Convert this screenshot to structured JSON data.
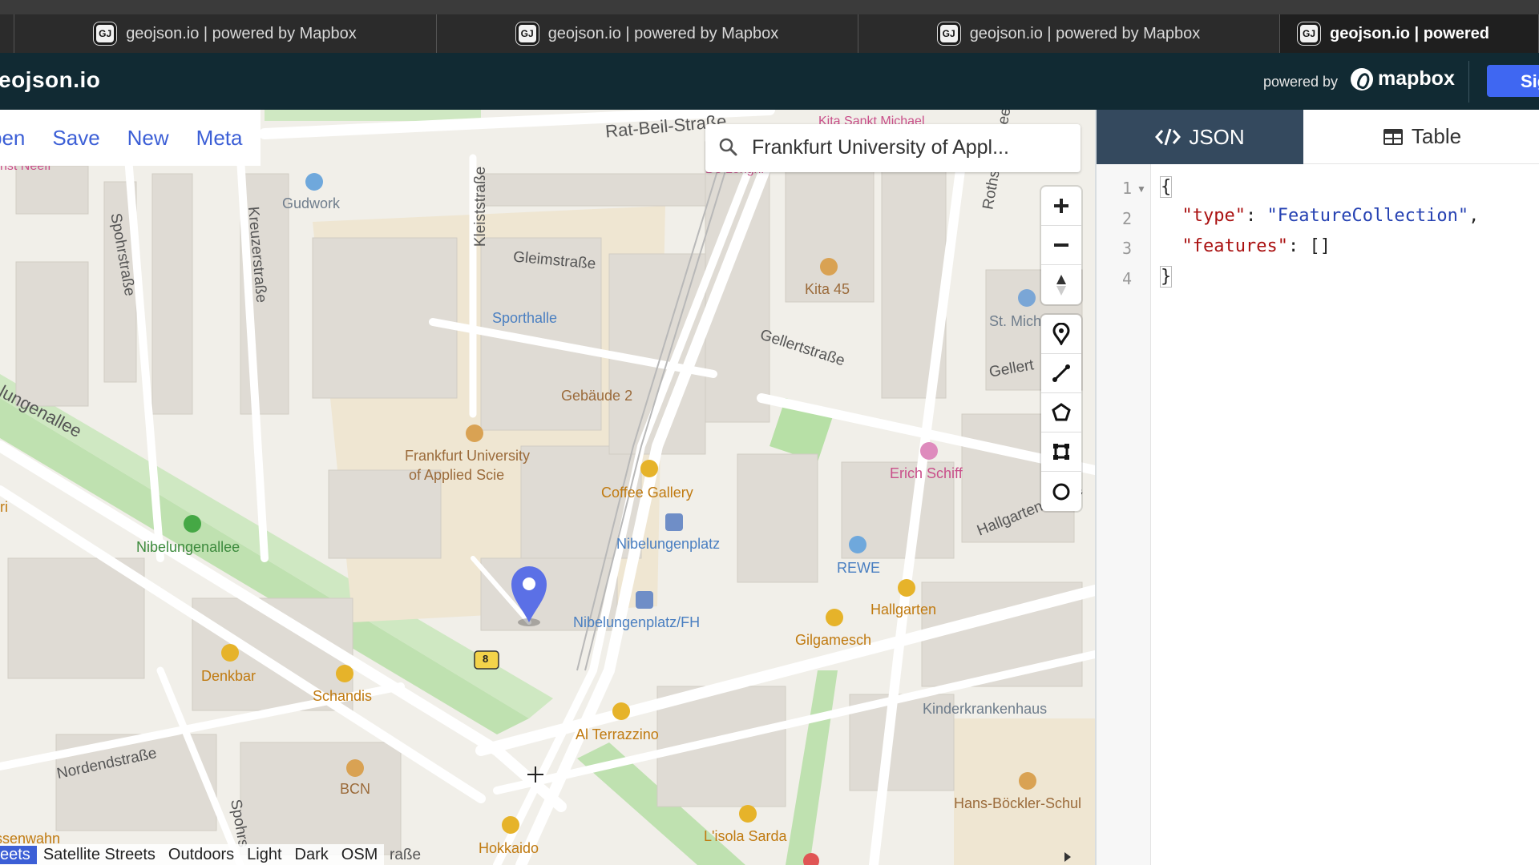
{
  "browser": {
    "tabs": [
      {
        "title": "geojson.io | powered by Mapbox",
        "favicon": "GJ"
      },
      {
        "title": "geojson.io | powered by Mapbox",
        "favicon": "GJ"
      },
      {
        "title": "geojson.io | powered by Mapbox",
        "favicon": "GJ"
      },
      {
        "title": "geojson.io | powered",
        "favicon": "GJ"
      }
    ]
  },
  "header": {
    "title": "eojson.io",
    "powered_by": "powered by",
    "mapbox": "mapbox",
    "signin": "Sign"
  },
  "menu": {
    "open": "pen",
    "save": "Save",
    "new": "New",
    "meta": "Meta"
  },
  "search": {
    "value": "Frankfurt University of Appl..."
  },
  "map": {
    "labels": {
      "ernst": "nst Neeff",
      "gudwork": "Gudwork",
      "ratbeil": "Rat-Beil-Straße",
      "kita_michael": "Kita Sankt Michael",
      "delonghi": "De Longhi",
      "spohr": "Spohrstraße",
      "kreuzer": "Kreuzerstraße",
      "kleist": "Kleiststraße",
      "gleim": "Gleimstraße",
      "sporthalle": "Sporthalle",
      "kita45": "Kita 45",
      "rothschild": "Rothschildallee",
      "stmich": "St. Mich",
      "geller": "Gellertstraße",
      "geller2": "Gellert",
      "gebaude": "Gebäude 2",
      "nibelungenallee_top": "lungenallee",
      "frankfurt_uni": "Frankfurt University",
      "applied": "of Applied Scie",
      "coffee": "Coffee Gallery",
      "erich": "Erich Schiff",
      "nibelungenplatz": "Nibelungenplatz",
      "nibelungenallee": "Nibelungenallee",
      "hallgarten_str": "Hallgartenstraße",
      "rewe": "REWE",
      "hallgarten": "Hallgarten",
      "nibelungenplatzfh": "Nibelungenplatz/FH",
      "gilgamesch": "Gilgamesch",
      "denkbar": "Denkbar",
      "schandis": "Schandis",
      "kinderkrankenhaus": "Kinderkrankenhaus",
      "alterrazzino": "Al Terrazzino",
      "nordend": "Nordendstraße",
      "bcn": "BCN",
      "spohr2": "Spohrs",
      "hansbockler": "Hans-Böckler-Schul",
      "lisola": "L'isola Sarda",
      "hokkaido": "Hokkaido",
      "ssenwahn": "ssenwahn",
      "ri": "ri",
      "route8": "8",
      "strasse_bottom": "raße"
    },
    "styles": [
      "eets",
      "Satellite Streets",
      "Outdoors",
      "Light",
      "Dark",
      "OSM"
    ],
    "selected_style": "eets",
    "marker_color": "#5b70e6"
  },
  "panel": {
    "tab_json": "JSON",
    "tab_table": "Table",
    "lines": [
      "1",
      "2",
      "3",
      "4"
    ],
    "code": {
      "open": "{",
      "type_key": "\"type\"",
      "type_val": "\"FeatureCollection\"",
      "features_key": "\"features\"",
      "features_val": "[]",
      "close": "}"
    }
  },
  "colors": {
    "header_bg": "#112a33",
    "accent": "#3c5fd6",
    "json_tab_bg": "#34495e",
    "signin_bg": "#3f67f2"
  }
}
